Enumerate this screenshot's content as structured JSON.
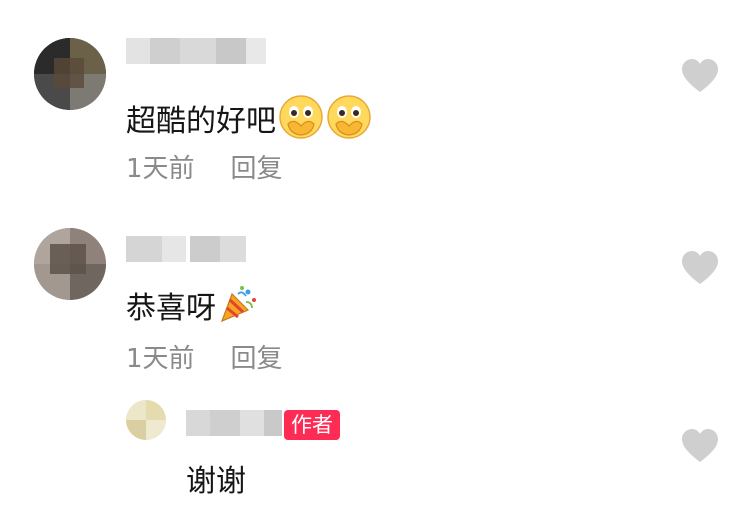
{
  "comments": [
    {
      "text": "超酷的好吧",
      "emojis": [
        "hands-over-mouth-emoji",
        "hands-over-mouth-emoji"
      ],
      "time": "1天前",
      "reply_label": "回复",
      "icons": {
        "like": "heart-icon"
      }
    },
    {
      "text": "恭喜呀",
      "emojis": [
        "party-popper-emoji"
      ],
      "time": "1天前",
      "reply_label": "回复",
      "icons": {
        "like": "heart-icon"
      }
    }
  ],
  "reply": {
    "badge": "作者",
    "text": "谢谢",
    "icons": {
      "like": "heart-icon"
    }
  },
  "colors": {
    "badge_bg": "#fe2c55",
    "meta_text": "#8a8a8a",
    "like_icon": "#cfcfcf"
  }
}
